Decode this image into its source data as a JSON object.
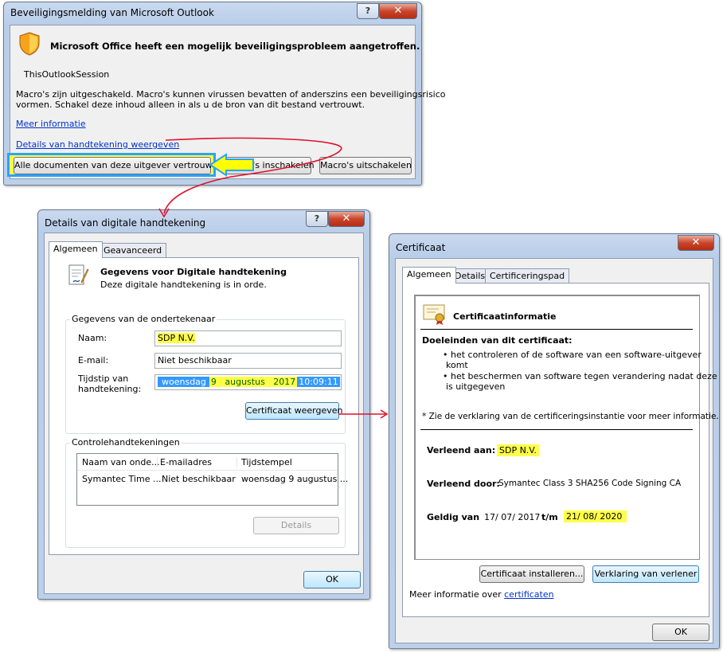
{
  "security_dialog": {
    "title": "Beveiligingsmelding van Microsoft Outlook",
    "help_label": "?",
    "close_label": "✕",
    "heading": "Microsoft Office heeft een mogelijk beveiligingsprobleem aangetroffen.",
    "session": "ThisOutlookSession",
    "warning_line1": "Macro's zijn uitgeschakeld. Macro's kunnen virussen bevatten of anderszins een beveiligingsrisico",
    "warning_line2": "vormen. Schakel deze inhoud alleen in als u de bron van dit bestand vertrouwt.",
    "more_info_link": "Meer informatie",
    "signature_details_link": "Details van handtekening weergeven",
    "trust_publisher_button": "Alle documenten van deze uitgever vertrouwen",
    "enable_macros_button": "Macro's inschakelen",
    "disable_macros_button": "Macro's uitschakelen"
  },
  "signature_dialog": {
    "title": "Details van digitale handtekening",
    "help_label": "?",
    "close_label": "✕",
    "tabs": [
      "Algemeen",
      "Geavanceerd"
    ],
    "heading": "Gegevens voor Digitale handtekening",
    "status": "Deze digitale handtekening is in orde.",
    "signer_group": "Gegevens van de ondertekenaar",
    "name_label": "Naam:",
    "name_value": "SDP N.V.",
    "email_label": "E-mail:",
    "email_value": "Niet beschikbaar",
    "time_label_1": "Tijdstip van",
    "time_label_2": "handtekening:",
    "time_value_day": "woensdag",
    "time_value_date": "9   augustus   2017",
    "time_value_time": "10:09:11",
    "view_cert_button": "Certificaat weergeven",
    "countersig_group": "Controlehandtekeningen",
    "table_headers": [
      "Naam van onde...",
      "E-mailadres",
      "Tijdstempel"
    ],
    "table_rows": [
      [
        "Symantec Time ...",
        "Niet beschikbaar",
        "woensdag 9 augustus ..."
      ]
    ],
    "details_button": "Details",
    "ok_button": "OK"
  },
  "certificate_dialog": {
    "title": "Certificaat",
    "close_label": "✕",
    "tabs": [
      "Algemeen",
      "Details",
      "Certificeringspad"
    ],
    "info_heading": "Certificaatinformatie",
    "purposes_heading": "Doeleinden van dit certificaat:",
    "purpose1_line1": "• het controleren of de software van een software-uitgever",
    "purpose1_line2": "komt",
    "purpose2_line1": "• het beschermen van software tegen verandering nadat deze",
    "purpose2_line2": "is uitgegeven",
    "note": "* Zie de verklaring van de certificeringsinstantie voor meer informatie.",
    "issued_to_label": "Verleend aan:",
    "issued_to_value": "SDP N.V.",
    "issued_by_label": "Verleend door:",
    "issued_by_value": "Symantec Class 3 SHA256 Code Signing CA",
    "valid_from_label": "Geldig van",
    "valid_from_value": "17/ 07/ 2017",
    "valid_to_label": "t/m",
    "valid_to_value": "21/ 08/ 2020",
    "install_button": "Certificaat installeren...",
    "issuer_statement_button": "Verklaring van verlener",
    "more_info_text": "Meer informatie over",
    "more_info_link": "certificaten",
    "ok_button": "OK"
  },
  "colors": {
    "highlight": "#ffff4a",
    "annotation_arrow": "#e0102a",
    "callout_arrow": "#ffff00",
    "callout_border": "#29a3ff",
    "link": "#0033cc"
  }
}
